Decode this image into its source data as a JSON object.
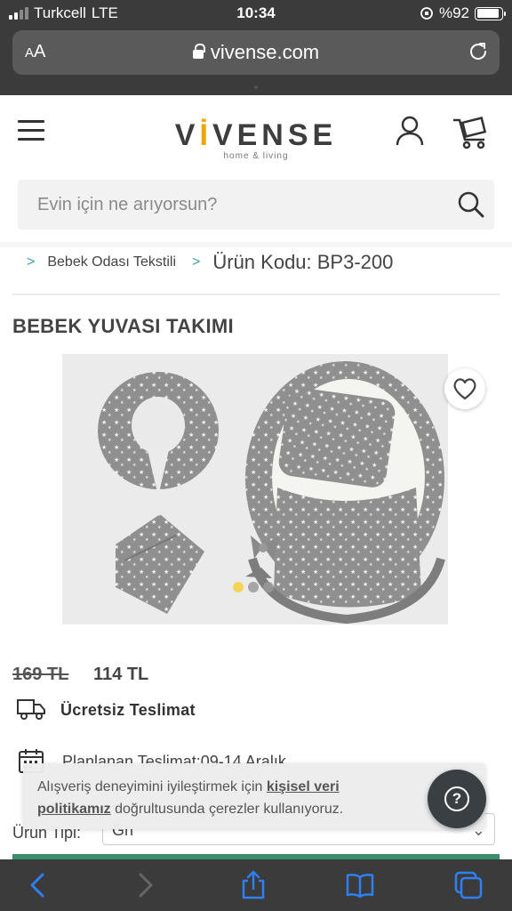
{
  "status_bar": {
    "carrier": "Turkcell",
    "network": "LTE",
    "time": "10:34",
    "battery": "%92"
  },
  "browser": {
    "text_size_button": "AA",
    "url": "vivense.com"
  },
  "header": {
    "logo": "VIVENSE",
    "logo_tagline": "home & living"
  },
  "search": {
    "placeholder": "Evin için ne arıyorsun?"
  },
  "breadcrumb": {
    "items": [
      "Bebek Odası Tekstili",
      "Ürün Kodu: BP3-200"
    ]
  },
  "product": {
    "title": "BEBEK YUVASI TAKIMI",
    "old_price": "169 TL",
    "new_price": "114 TL",
    "free_shipping": "Ücretsiz Teslimat",
    "planned_delivery": "Planlanan Teslimat:09-14 Aralık",
    "type_label": "Ürün Tipi:",
    "type_value": "Gri",
    "gallery_count": 3,
    "gallery_active": 1
  },
  "cookie_banner": {
    "text_before": "Alışveriş deneyimini iyileştirmek için ",
    "link": "kişisel veri politikamız",
    "text_after": " doğrultusunda çerezler kullanıyoruz."
  },
  "colors": {
    "accent_teal": "#3aa0a0",
    "logo_dot": "#f0a500",
    "gallery_active_dot": "#f4d03f",
    "browser_chrome": "#3b3b3b",
    "toolbar_icon": "#2f7ff5"
  },
  "icons": {
    "menu": "hamburger-icon",
    "account": "user-icon",
    "cart": "cart-icon",
    "search": "search-icon",
    "favorite": "heart-icon",
    "shipping": "truck-icon",
    "delivery": "calendar-icon",
    "help": "question-icon"
  }
}
